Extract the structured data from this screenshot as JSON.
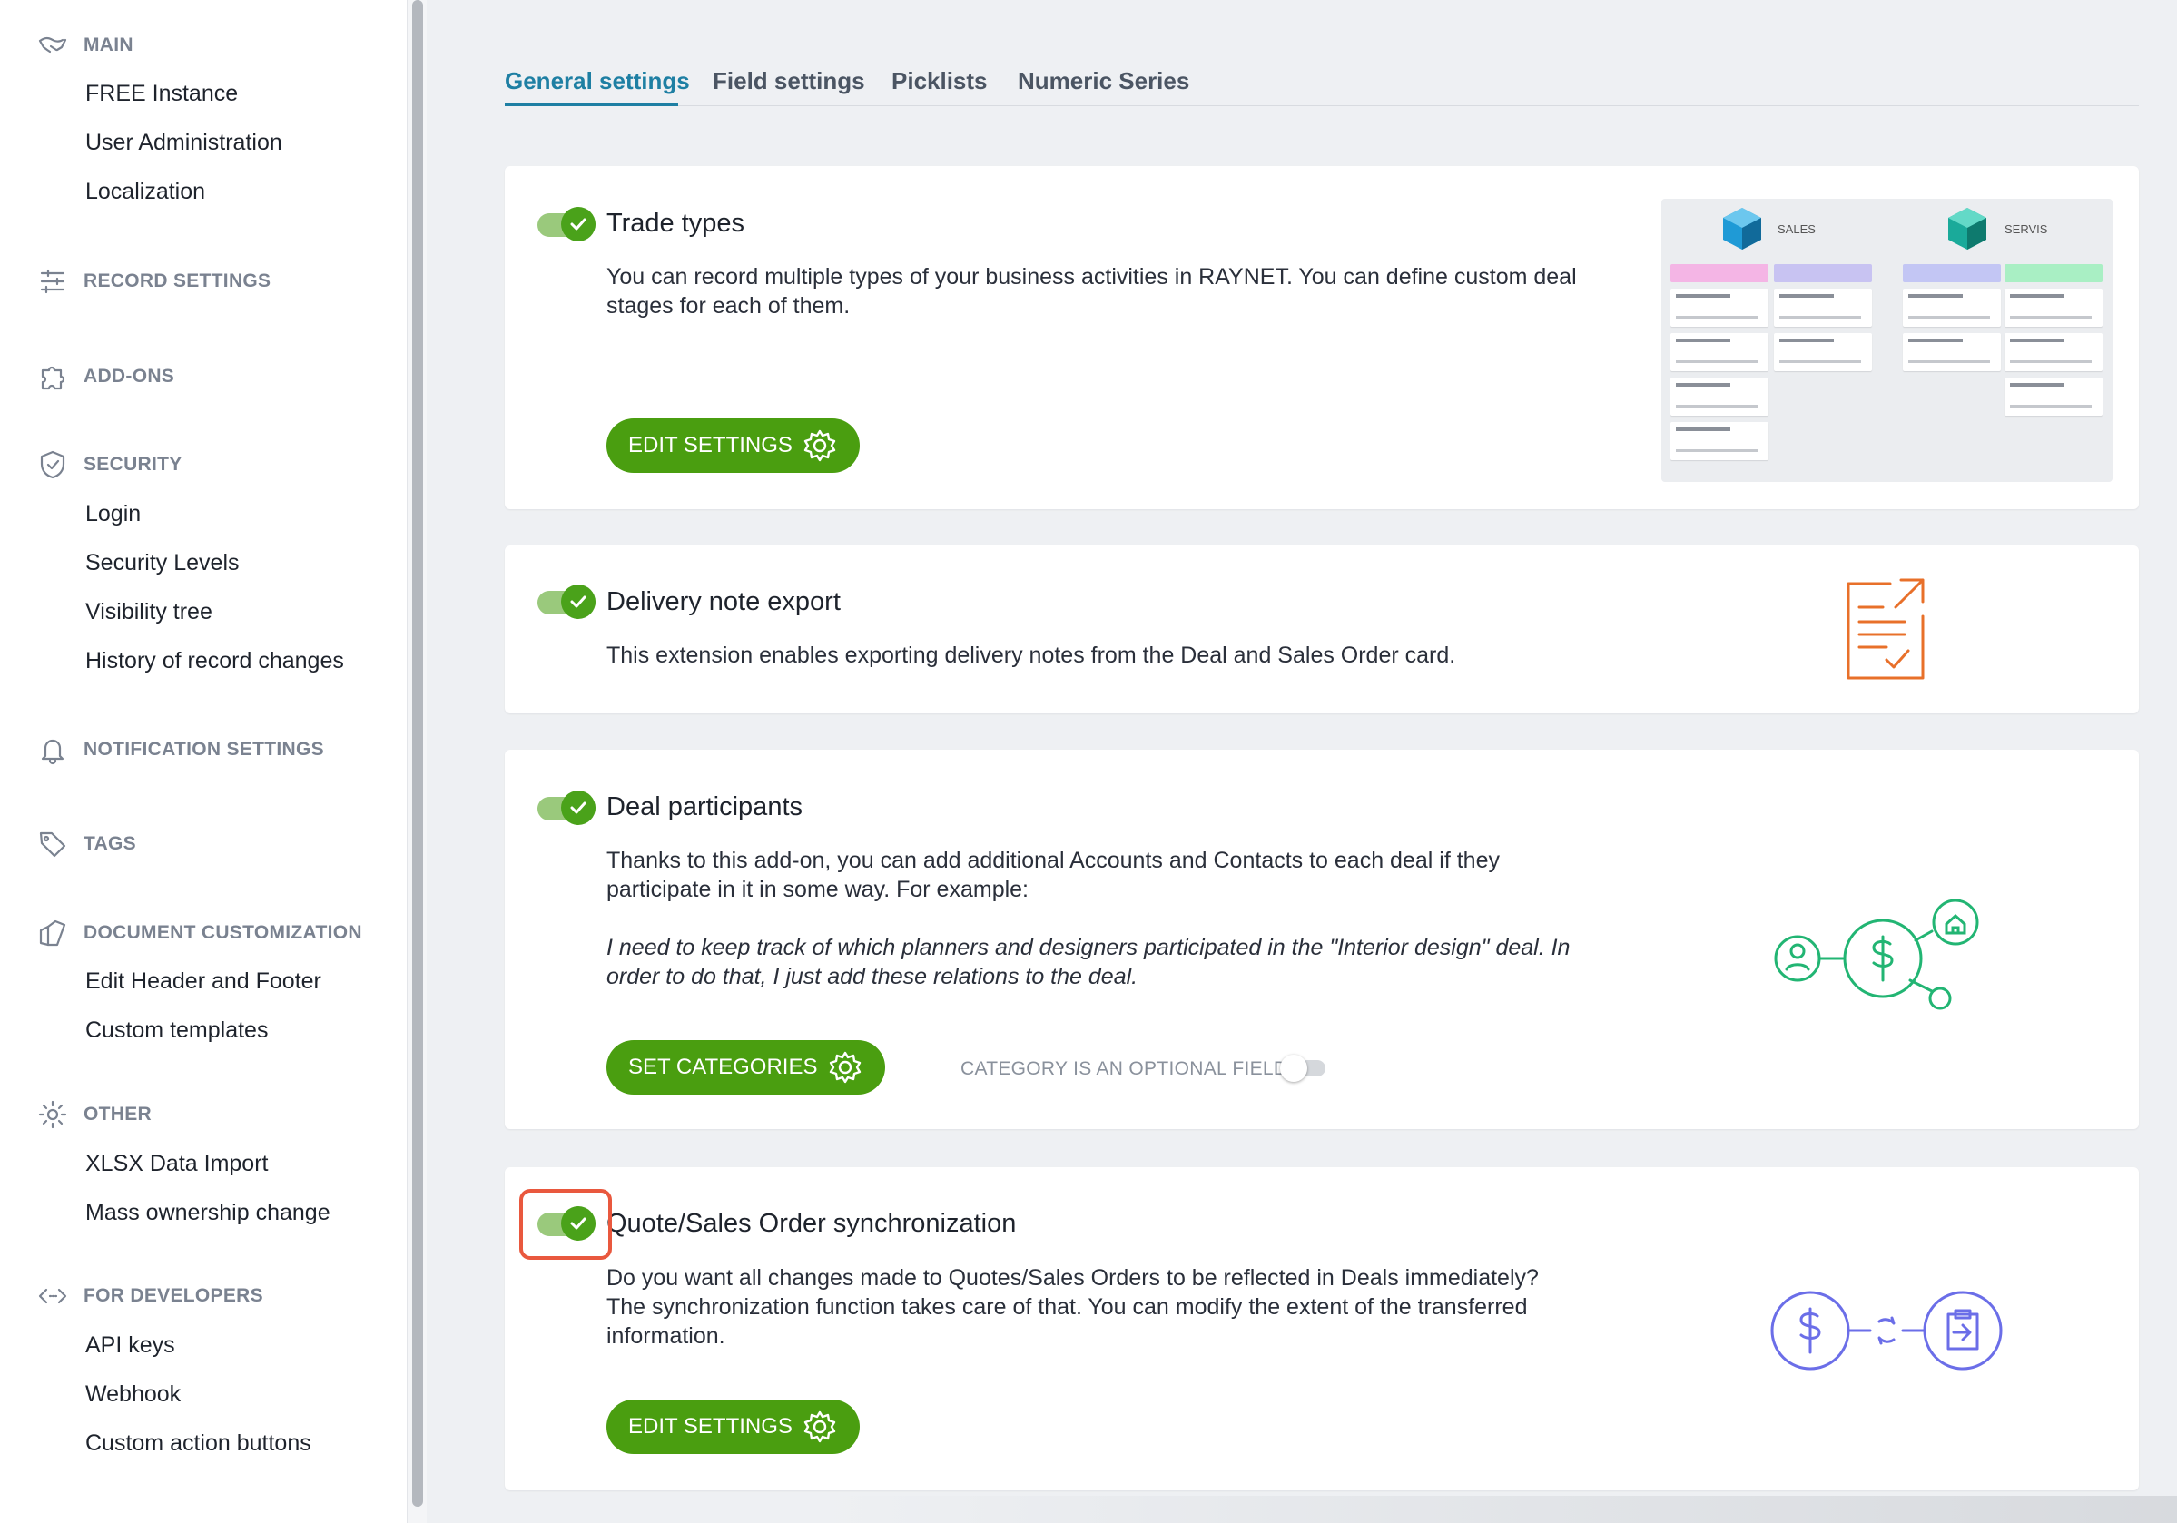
{
  "sidebar": {
    "sections": [
      {
        "title": "MAIN",
        "icon": "handshake-icon",
        "items": [
          "FREE Instance",
          "User Administration",
          "Localization"
        ]
      },
      {
        "title": "RECORD SETTINGS",
        "icon": "sliders-icon",
        "items": []
      },
      {
        "title": "ADD-ONS",
        "icon": "puzzle-icon",
        "items": []
      },
      {
        "title": "SECURITY",
        "icon": "shield-icon",
        "items": [
          "Login",
          "Security Levels",
          "Visibility tree",
          "History of record changes"
        ]
      },
      {
        "title": "NOTIFICATION SETTINGS",
        "icon": "bell-icon",
        "items": []
      },
      {
        "title": "TAGS",
        "icon": "tag-icon",
        "items": []
      },
      {
        "title": "DOCUMENT CUSTOMIZATION",
        "icon": "documents-icon",
        "items": [
          "Edit Header and Footer",
          "Custom templates"
        ]
      },
      {
        "title": "OTHER",
        "icon": "gear-icon",
        "items": [
          "XLSX Data Import",
          "Mass ownership change"
        ]
      },
      {
        "title": "FOR DEVELOPERS",
        "icon": "code-icon",
        "items": [
          "API keys",
          "Webhook",
          "Custom action buttons"
        ]
      }
    ]
  },
  "tabs": [
    {
      "label": "General settings",
      "active": true
    },
    {
      "label": "Field settings",
      "active": false
    },
    {
      "label": "Picklists",
      "active": false
    },
    {
      "label": "Numeric Series",
      "active": false
    }
  ],
  "cards": {
    "trade_types": {
      "enabled": true,
      "title": "Trade types",
      "description": "You can record multiple types of your business activities in RAYNET. You can define custom deal stages for each of them.",
      "button": "EDIT SETTINGS",
      "preview": {
        "left_label": "SALES",
        "right_label": "SERVIS"
      }
    },
    "delivery_note": {
      "enabled": true,
      "title": "Delivery note export",
      "description": "This extension enables exporting delivery notes from the Deal and Sales Order card."
    },
    "deal_participants": {
      "enabled": true,
      "title": "Deal participants",
      "description": "Thanks to this add-on, you can add additional Accounts and Contacts to each deal if they participate in it in some way. For example:",
      "example": "I need to keep track of which planners and designers participated in the \"Interior design\" deal. In order to do that, I just add these relations to the deal.",
      "button": "SET CATEGORIES",
      "optional_label": "CATEGORY IS AN OPTIONAL FIELD",
      "optional_enabled": false
    },
    "quote_sync": {
      "enabled": true,
      "title": "Quote/Sales Order synchronization",
      "description": "Do you want all changes made to Quotes/Sales Orders to be reflected in Deals immediately? The synchronization function takes care of that. You can modify the extent of the transferred information.",
      "button": "EDIT SETTINGS"
    }
  },
  "colors": {
    "accent_green": "#4a9e10",
    "tab_active": "#1e7fa3",
    "highlight": "#e9583e",
    "orange_icon": "#e8702a",
    "teal_icon": "#22b573",
    "purple_icon": "#6b6ee8"
  }
}
